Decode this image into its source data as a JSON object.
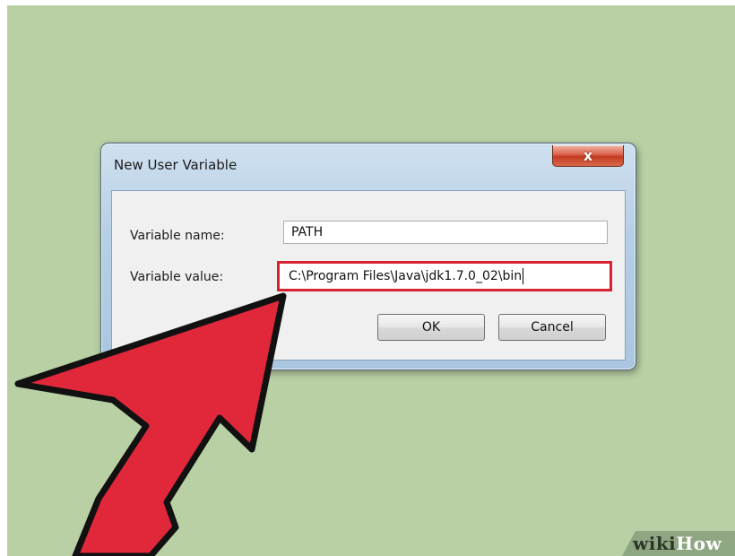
{
  "dialog": {
    "title": "New User Variable",
    "close_label": "x",
    "variable_name_label": "Variable name:",
    "variable_name_value": "PATH",
    "variable_value_label": "Variable value:",
    "variable_value_value": "C:\\Program Files\\Java\\jdk1.7.0_02\\bin",
    "ok_label": "OK",
    "cancel_label": "Cancel"
  },
  "watermark": {
    "part1": "wiki",
    "part2": "How"
  },
  "colors": {
    "background": "#b9d0a4",
    "arrow": "#e0283a",
    "highlight_border": "#d72231"
  },
  "icons": {
    "close": "close-icon",
    "pointer": "pointer-arrow-icon"
  }
}
